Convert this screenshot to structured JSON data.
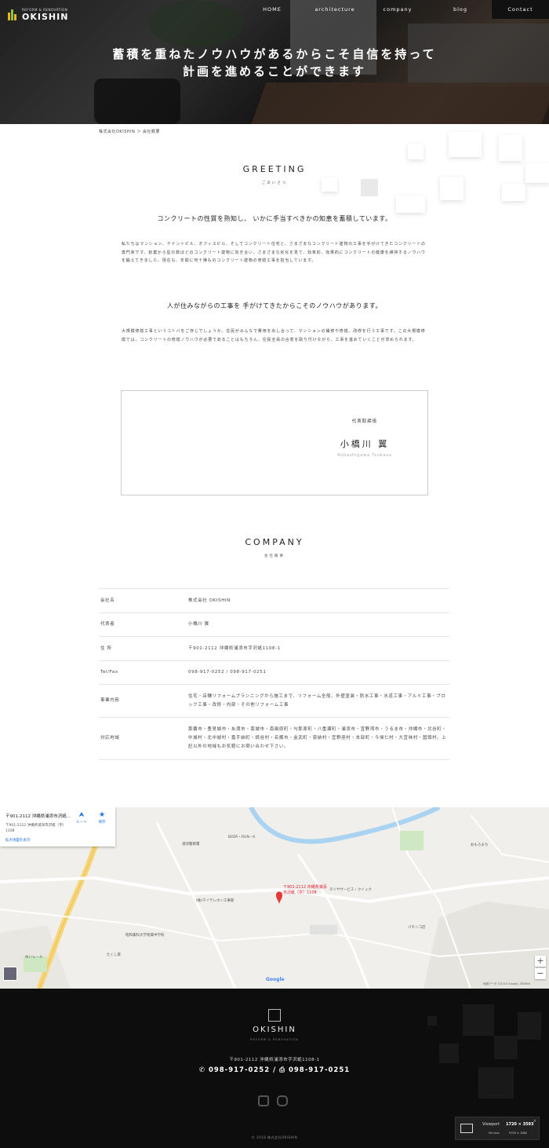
{
  "logo": {
    "sub": "REFORM & RENOVATION",
    "main": "OKISHIN"
  },
  "nav": {
    "items": [
      "HOME",
      "architecture",
      "company",
      "blog"
    ],
    "contact": "Contact"
  },
  "hero": {
    "line1": "蓄積を重ねたノウハウがあるからこそ自信を持って",
    "line2": "計画を進めることができます"
  },
  "breadcrumb": "株式会社OKISHIN ＞ 会社概要",
  "greeting": {
    "title": "GREETING",
    "sub": "ごあいさつ",
    "lead1": "コンクリートの性質を熟知し、 いかに手当すべきかの知恵を蓄積しています。",
    "body1": "私たちはマンション、テナントビル、オフィスビル、そしてコンクリート住宅と、さまざまなコンクリート建物の工事を手がけてきたコンクリートの専門家です。創業から星の数ほどのコンクリート建物に向き合い、さまざまな劣化を見て、効率的、効果的にコンクリートの健康を維持するノウハウを鍛えてきました。現在も、年間に何十棟ものコンクリート建物の修繕工事を担当しています。",
    "lead2": "人が住みながらの工事を 手がけてきたからこそのノウハウがあります。",
    "body2": "大規模修繕工事というコトバをご存じでしょうか。住民がみんなで費用を出し合って、マンションの補修や修繕、改修を行う工事です。この大規模修繕では、コンクリートの修繕ノウハウが必要であることはもちろん、住民全員の合意を取り付けながら、工事を進めていくことが求められます。"
  },
  "ceo": {
    "role": "代表取締役",
    "name": "小橋川 翼",
    "roma": "Kobashigawa Tsubasa"
  },
  "company": {
    "title": "COMPANY",
    "sub": "会社概要",
    "rows": [
      {
        "k": "会社名",
        "v": "株式会社 OKISHIN"
      },
      {
        "k": "代表者",
        "v": "小橋川 翼"
      },
      {
        "k": "住 所",
        "v": "〒901-2112 沖縄県浦添市字沢岻1108-1"
      },
      {
        "k": "Tel/Fax",
        "v": "098-917-0252 / 098-917-0251"
      },
      {
        "k": "事業内容",
        "v": "住宅・店舗リフォームプランニングから施工まで、リフォーム全般、外壁塗装・防水工事・水道工事・アルミ工事・ブロック工事・改修・内部・その他リフォーム工事"
      },
      {
        "k": "対応地域",
        "v": "那覇市・豊見城市・糸満市・南城市・南風原町・与那原町・八重瀬町・浦添市・宜野湾市・うるま市・沖縄市・北谷町・中城村・北中城村・嘉手納町・読谷村・名護市・金武町・恩納村・宜野座村・本部町・今帰仁村・大宜味村・国頭村。上記以外の地域もお気軽にお問い合わせ下さい。"
      }
    ]
  },
  "map": {
    "card_title": "〒901-2112 沖縄県浦添市沢岻...",
    "card_addr": "〒901-2112 沖縄県浦添市沢岻（字）1108",
    "card_link": "拡大地図を表示",
    "route": "ルート",
    "save": "保存",
    "pin": "〒901-2112 沖縄県浦添市沢岻（字）1108",
    "zoom_in": "+",
    "zoom_out": "−",
    "google": "Google",
    "copyright": "地図データ ©2019 Google, ZENRIN",
    "labels": [
      "BODY・RUN・K",
      "タイヤサービス・クイック",
      "浦添警察署",
      "(株)マイテレホン工事部",
      "たくし家",
      "昭和薬科大学附属中学校",
      "ゆいレール",
      "おもろまち",
      "パチンコ店"
    ]
  },
  "footer": {
    "logo": "OKISHIN",
    "logo_sub": "REFORM & RENOVATION",
    "addr": "〒901-2112 沖縄県浦添市字沢岻1108-1",
    "tel": "098-917-0252",
    "fax": "098-917-0251",
    "copy": "© 2018 株式会社OKISHIN"
  },
  "viewport": {
    "label": "Viewport",
    "value": "1720 × 3593",
    "wlabel": "Window",
    "wvalue": "5753 × 1082"
  }
}
